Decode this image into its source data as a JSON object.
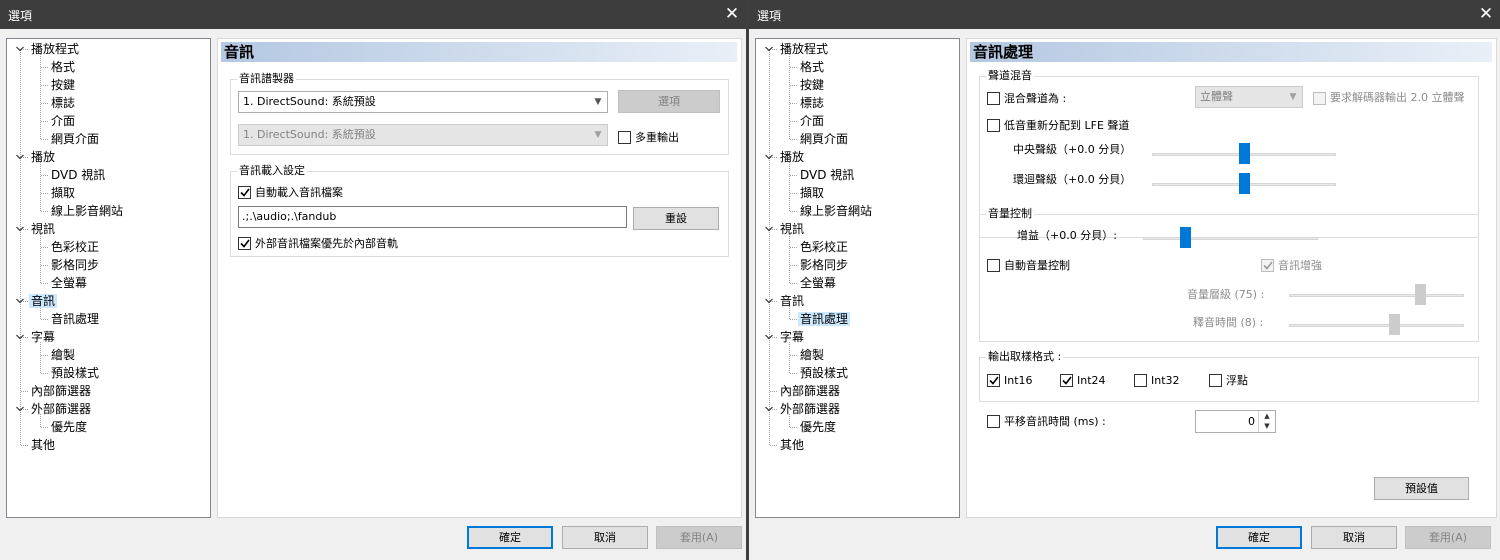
{
  "left": {
    "title": "選項",
    "close_glyph": "✕",
    "page_title": "音訊",
    "renderer": {
      "label": "音訊譜製器",
      "device": "1. DirectSound: 系統預設",
      "options_button": "選項",
      "device2": "1. DirectSound: 系統預設",
      "multi_output": "多重輸出"
    },
    "load": {
      "label": "音訊載入設定",
      "auto_load": "自動載入音訊檔案",
      "paths": ".;.\\audio;.\\fandub",
      "reset_button": "重設",
      "prefer_external": "外部音訊檔案優先於內部音軌"
    },
    "footer": {
      "ok": "確定",
      "cancel": "取消",
      "apply": "套用(A)"
    }
  },
  "right": {
    "title": "選項",
    "close_glyph": "✕",
    "page_title": "音訊處理",
    "mixer": {
      "label": "聲道混音",
      "mix_to": "混合聲道為 :",
      "mix_value": "立體聲",
      "decoder_stereo": "要求解碼器輸出 2.0 立體聲",
      "lfe": "低音重新分配到 LFE 聲道",
      "center": "中央聲級（+0.0 分貝）",
      "surround": "環迴聲級（+0.0 分貝）",
      "center_level": 0.5,
      "surround_level": 0.5
    },
    "volume": {
      "label": "音量控制",
      "gain": "增益（+0.0 分貝）:",
      "gain_level": 0.24,
      "auto_volume": "自動音量控制",
      "boost": "音訊增強",
      "norm_level": "音量層級 (75) :",
      "norm_level_value": 0.75,
      "release_time": "釋音時間 (8) :",
      "release_time_value": 0.6
    },
    "sample_format": {
      "label": "輸出取樣格式 :",
      "int16": "Int16",
      "int24": "Int24",
      "int32": "Int32",
      "float": "浮點"
    },
    "shift": {
      "label": "平移音訊時間 (ms) :",
      "value": "0"
    },
    "defaults_button": "預設值",
    "footer": {
      "ok": "確定",
      "cancel": "取消",
      "apply": "套用(A)"
    }
  },
  "tree": {
    "player": "播放程式",
    "formats": "格式",
    "keys": "按鍵",
    "logo": "標誌",
    "interface": "介面",
    "web": "網頁介面",
    "playback": "播放",
    "dvd": "DVD 視訊",
    "capture": "擷取",
    "online": "線上影音網站",
    "video": "視訊",
    "color": "色彩校正",
    "sync": "影格同步",
    "fullscreen": "全螢幕",
    "audio": "音訊",
    "audio_proc": "音訊處理",
    "subtitles": "字幕",
    "render": "繪製",
    "default_style": "預設樣式",
    "internal_filters": "內部篩選器",
    "external_filters": "外部篩選器",
    "priority": "優先度",
    "misc": "其他"
  }
}
